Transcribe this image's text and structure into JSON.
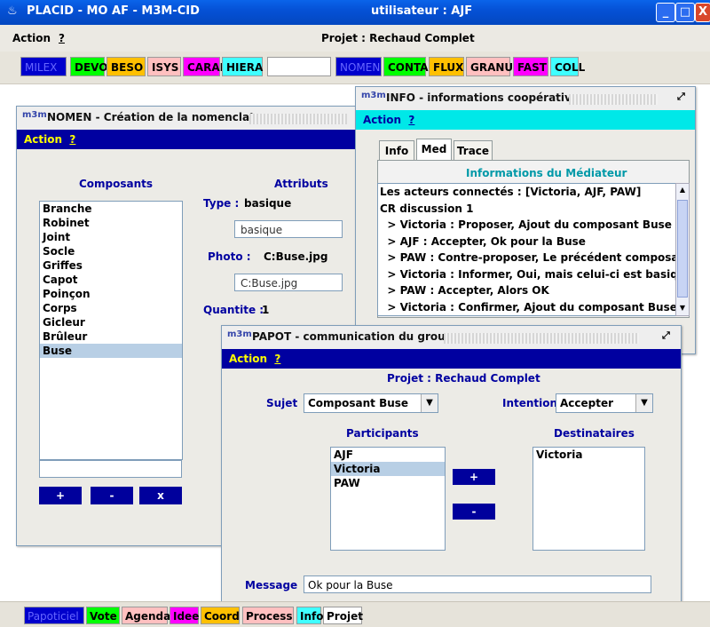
{
  "window": {
    "title": "PLACID - MO AF - M3M-CID",
    "user": "utilisateur : AJF",
    "min": "_",
    "max": "□",
    "close": "X"
  },
  "menubar": {
    "action": "Action",
    "help": "?",
    "project": "Projet : Rechaud Complet"
  },
  "toolbar": [
    {
      "label": "MILEX",
      "bg": "#0000cc",
      "fg": "#6666ff"
    },
    {
      "label": "DEVO",
      "bg": "#00ff00",
      "fg": "#000000"
    },
    {
      "label": "BESO",
      "bg": "#ffc000",
      "fg": "#000000"
    },
    {
      "label": "ISYS",
      "bg": "#ffc0c0",
      "fg": "#000000"
    },
    {
      "label": "CARAF",
      "bg": "#ff00ff",
      "fg": "#000000"
    },
    {
      "label": "HIERA",
      "bg": "#40ffff",
      "fg": "#000000"
    },
    {
      "label": "",
      "bg": "#ffffff",
      "fg": "#000000"
    },
    {
      "label": "NOMEN",
      "bg": "#0000cc",
      "fg": "#6666ff"
    },
    {
      "label": "CONTA",
      "bg": "#00ff00",
      "fg": "#000000"
    },
    {
      "label": "FLUX",
      "bg": "#ffc000",
      "fg": "#000000"
    },
    {
      "label": "GRANU",
      "bg": "#ffc0c0",
      "fg": "#000000"
    },
    {
      "label": "FAST",
      "bg": "#ff00ff",
      "fg": "#000000"
    },
    {
      "label": "COLL",
      "bg": "#40ffff",
      "fg": "#000000"
    }
  ],
  "nomen": {
    "logo": "m3m",
    "title": "NOMEN - Création de la nomenclature",
    "action": "Action",
    "help": "?",
    "components_header": "Composants",
    "attributes_header": "Attributs",
    "components": [
      "Branche",
      "Robinet",
      "Joint",
      "Socle",
      "Griffes",
      "Capot",
      "Poinçon",
      "Corps",
      "Gicleur",
      "Brûleur",
      "Buse"
    ],
    "selected_index": 10,
    "type_label": "Type :",
    "type_value": "basique",
    "type_field": "basique",
    "photo_label": "Photo :",
    "photo_value": "C:Buse.jpg",
    "photo_field": "C:Buse.jpg",
    "quantity_label": "Quantite :",
    "quantity_value": "1",
    "btn_add": "+",
    "btn_remove": "-",
    "btn_delete": "x"
  },
  "info": {
    "logo": "m3m",
    "title": "INFO - informations coopératives",
    "action": "Action",
    "help": "?",
    "tabs": [
      "Info",
      "Med",
      "Trace"
    ],
    "active_tab": "Med",
    "heading": "Informations du Médiateur",
    "lines": [
      "Les acteurs connectés : [Victoria, AJF, PAW]",
      "CR discussion 1",
      "  > Victoria : Proposer, Ajout du composant Buse",
      "  > AJF : Accepter, Ok pour la Buse",
      "  > PAW : Contre-proposer, Le précédent composant Buse",
      "  > Victoria : Informer, Oui, mais celui-ci est basique",
      "  > PAW : Accepter, Alors OK",
      "  > Victoria : Confirmer, Ajout du composant Buse"
    ]
  },
  "papot": {
    "logo": "m3m",
    "title": "PAPOT - communication du groupe",
    "action": "Action",
    "help": "?",
    "project": "Projet : Rechaud Complet",
    "subject_label": "Sujet",
    "subject_value": "Composant Buse",
    "intention_label": "Intention",
    "intention_value": "Accepter",
    "participants_header": "Participants",
    "participants": [
      "AJF",
      "Victoria",
      "PAW"
    ],
    "participants_selected": 1,
    "recipients_header": "Destinataires",
    "recipients": [
      "Victoria"
    ],
    "btn_add": "+",
    "btn_remove": "-",
    "message_label": "Message",
    "message_value": "Ok pour la Buse"
  },
  "bottombar": [
    {
      "label": "Papoticiel",
      "bg": "#0000cc",
      "fg": "#6666ff"
    },
    {
      "label": "Vote",
      "bg": "#00ff00",
      "fg": "#000000"
    },
    {
      "label": "Agenda",
      "bg": "#ffc0c0",
      "fg": "#000000"
    },
    {
      "label": "Idee",
      "bg": "#ff00ff",
      "fg": "#000000"
    },
    {
      "label": "Coord",
      "bg": "#ffc000",
      "fg": "#000000"
    },
    {
      "label": "Process",
      "bg": "#ffc0c0",
      "fg": "#000000"
    },
    {
      "label": "Info",
      "bg": "#40ffff",
      "fg": "#000000"
    },
    {
      "label": "Projet",
      "bg": "#ffffff",
      "fg": "#000000"
    }
  ]
}
